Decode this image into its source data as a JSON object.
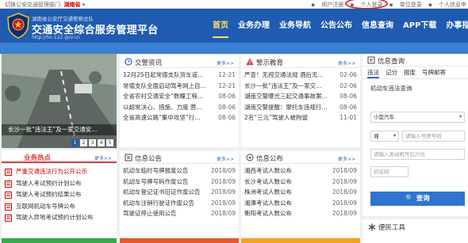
{
  "topbar": {
    "switch_label": "切换公安交通管理部门:",
    "province": "湖南省",
    "links": [
      "用户注册",
      "个人登录",
      "单位登录",
      "个人信息申"
    ]
  },
  "header": {
    "org": "湖南省公安厅交通警察总队",
    "title": "交通安全综合服务管理平台",
    "url": "http://hn.122.gov.cn",
    "nav": [
      "首页",
      "业务办理",
      "业务导航",
      "公告公布",
      "信息查询",
      "APP下载",
      "办事指"
    ]
  },
  "slide": {
    "caption": "长沙一批“违法王”及一家交通安...",
    "badge": "长沙",
    "pages": [
      "1",
      "2",
      "3",
      "4",
      "5"
    ],
    "active_page": 1
  },
  "traffic_news": {
    "title": "交警资讯",
    "more": "更多>>",
    "items": [
      {
        "text": "12月25日起常德支队货车道...",
        "date": "12-21"
      },
      {
        "text": "常德支队全面启动驾考网上自...",
        "date": "12-21"
      },
      {
        "text": "全省农村交通安全“数糧工程...",
        "date": "08-06"
      },
      {
        "text": "以超常决心、措施、力度 营...",
        "date": "08-06"
      },
      {
        "text": "全省高速公路“集中攻坚”行...",
        "date": "08-06"
      }
    ]
  },
  "warning_edu": {
    "title": "警示教育",
    "more": "更多>>",
    "items": [
      {
        "text": "严查！无视交通法规 酒后无...",
        "date": "02-06"
      },
      {
        "text": "长沙一批“违法王”及一家交...",
        "date": "02-06"
      },
      {
        "text": "湖南交警曝光三起交通事故案...",
        "date": "08-06"
      },
      {
        "text": "湖南交警提醒：摩托车违规行...",
        "date": "08-06"
      },
      {
        "text": "2名“三元”驾驶人被拘留",
        "date": "11-01"
      }
    ]
  },
  "hot": {
    "title": "业务热点",
    "more": "更多>>",
    "items": [
      "严重交通违法行为公开公示",
      "驾驶人考试预约计划公布",
      "驾驶人考试预约结果公布",
      "互联网机动车号牌公布",
      "驾驶人异地考试预约计划公布"
    ]
  },
  "info_notice": {
    "title": "信息公告",
    "more": "更多>>",
    "items": [
      {
        "text": "机动车临时号牌报废公告",
        "date": "2018/09"
      },
      {
        "text": "机动车号牌号码作废公告",
        "date": "2018/09"
      },
      {
        "text": "机动车登记证书旧证作废公告",
        "date": "2018/09"
      },
      {
        "text": "机动车注销行驶证作废公告",
        "date": "2018/09"
      },
      {
        "text": "驾驶证停止使用公告",
        "date": "2018/09"
      }
    ]
  },
  "info_publish": {
    "title": "信息公布",
    "more": "更多>>",
    "items": [
      {
        "text": "湘西考试人数公布",
        "date": "2018/09"
      },
      {
        "text": "长沙考试人数公布",
        "date": "2018/09"
      },
      {
        "text": "株洲考试人数公布",
        "date": "2018/09"
      },
      {
        "text": "湘潭考试人数公布",
        "date": "2018/09"
      },
      {
        "text": "衡阳考试人数公布",
        "date": "2018/09"
      }
    ]
  },
  "query": {
    "title": "信息查询",
    "tabs": [
      "违法",
      "记分",
      "报废",
      "号牌邮寄"
    ],
    "form_label": "机动车违法查询",
    "vehicle_type": "小型汽车",
    "province_prefix": "湘",
    "plate_placeholder": "请输入号牌号码",
    "engine_placeholder": "请输入发动机号后六位",
    "captcha_placeholder": "验证码",
    "button": "查询"
  },
  "utilities": {
    "title": "便民工具"
  }
}
